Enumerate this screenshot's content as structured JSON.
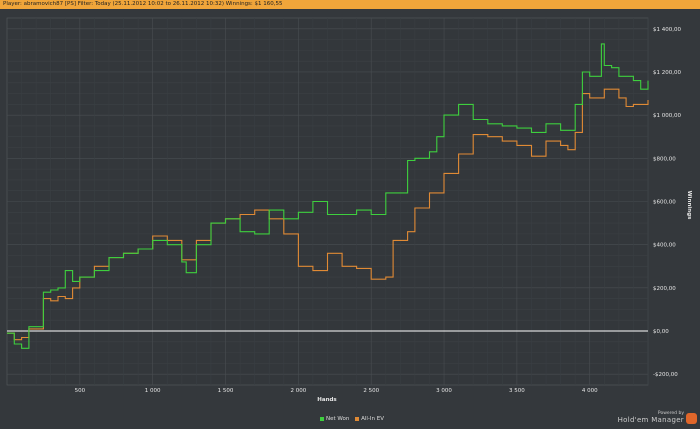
{
  "title": "Player: abramovich87 [PS]  Filter: Today (25.11.2012 10:02 to 26.11.2012 10:32)  Winnings: $1 160,55",
  "branding": {
    "powered": "Powered by",
    "name": "Hold'em Manager",
    "logo": "2"
  },
  "colors": {
    "net_won": "#3ecf3e",
    "all_in_ev": "#e08a35",
    "zero": "#ffffff"
  },
  "chart_data": {
    "type": "line",
    "xlabel": "Hands",
    "ylabel": "Winnings",
    "xlim": [
      0,
      4400
    ],
    "ylim": [
      -250,
      1450
    ],
    "xticks": [
      500,
      1000,
      1500,
      2000,
      2500,
      3000,
      3500,
      4000
    ],
    "xtick_labels": [
      "500",
      "1 000",
      "1 500",
      "2 000",
      "2 500",
      "3 000",
      "3 500",
      "4 000"
    ],
    "yticks": [
      -200,
      0,
      200,
      400,
      600,
      800,
      1000,
      1200,
      1400
    ],
    "ytick_labels": [
      "-$200,00",
      "$0,00",
      "$200,00",
      "$400,00",
      "$600,00",
      "$800,00",
      "$1 000,00",
      "$1 200,00",
      "$1 400,00"
    ],
    "legend": "bottom-center",
    "grid": true,
    "series": [
      {
        "name": "Net Won",
        "x": [
          0,
          50,
          100,
          150,
          200,
          250,
          300,
          350,
          400,
          450,
          500,
          600,
          700,
          800,
          900,
          1000,
          1100,
          1200,
          1230,
          1300,
          1400,
          1500,
          1600,
          1700,
          1800,
          1900,
          2000,
          2100,
          2200,
          2300,
          2400,
          2500,
          2600,
          2700,
          2750,
          2800,
          2900,
          2950,
          3000,
          3100,
          3200,
          3300,
          3400,
          3500,
          3600,
          3700,
          3800,
          3900,
          3950,
          4000,
          4080,
          4100,
          4150,
          4200,
          4300,
          4350,
          4400
        ],
        "y": [
          -10,
          -60,
          -80,
          20,
          20,
          180,
          190,
          200,
          280,
          230,
          250,
          280,
          340,
          360,
          380,
          420,
          400,
          320,
          270,
          400,
          500,
          520,
          460,
          450,
          560,
          520,
          550,
          600,
          540,
          540,
          560,
          540,
          640,
          640,
          790,
          800,
          830,
          900,
          1000,
          1050,
          980,
          960,
          950,
          940,
          920,
          960,
          930,
          1050,
          1200,
          1180,
          1330,
          1230,
          1220,
          1180,
          1160,
          1120,
          1160
        ]
      },
      {
        "name": "All-In EV",
        "x": [
          0,
          50,
          100,
          150,
          200,
          250,
          300,
          350,
          400,
          450,
          500,
          600,
          700,
          800,
          900,
          1000,
          1100,
          1200,
          1300,
          1400,
          1500,
          1600,
          1700,
          1800,
          1900,
          2000,
          2100,
          2200,
          2300,
          2400,
          2500,
          2600,
          2650,
          2750,
          2800,
          2900,
          3000,
          3100,
          3200,
          3300,
          3400,
          3500,
          3600,
          3700,
          3800,
          3850,
          3900,
          3950,
          4000,
          4100,
          4200,
          4250,
          4300,
          4400
        ],
        "y": [
          -10,
          -40,
          -30,
          10,
          10,
          150,
          140,
          160,
          150,
          200,
          250,
          300,
          340,
          360,
          380,
          440,
          420,
          330,
          420,
          500,
          520,
          540,
          560,
          520,
          450,
          300,
          280,
          360,
          300,
          290,
          240,
          250,
          420,
          460,
          570,
          640,
          730,
          820,
          910,
          900,
          880,
          860,
          810,
          880,
          860,
          840,
          920,
          1100,
          1080,
          1120,
          1080,
          1040,
          1050,
          1070
        ]
      }
    ]
  }
}
